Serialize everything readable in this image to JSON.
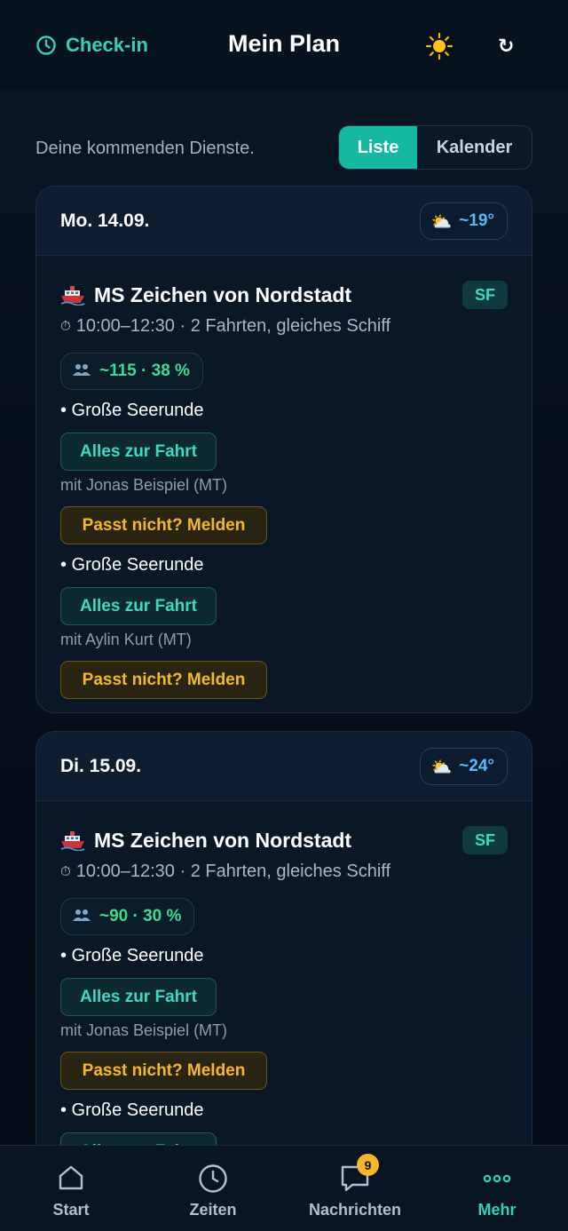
{
  "header": {
    "checkin_label": "Check-in",
    "title": "Mein Plan",
    "theme_icon": "sun-icon",
    "refresh_icon": "↻"
  },
  "subheader": {
    "subtitle": "Deine kommenden Dienste.",
    "view_toggle": {
      "list": "Liste",
      "calendar": "Kalender",
      "selected": "Liste"
    }
  },
  "days": [
    {
      "date": "Mo. 14.09.",
      "weather": {
        "icon": "⛅",
        "temp": "~19°"
      },
      "shift": {
        "ship": "MS Zeichen von Nordstadt",
        "badge": "SF",
        "clock_icon": "⏱",
        "time": "10:00–12:30 · 2 Fahrten, gleiches Schiff",
        "occupancy": "~115 · 38 %",
        "trips": [
          {
            "title": "• Große Seerunde",
            "details_label": "Alles zur Fahrt",
            "partner": "mit Jonas Beispiel (MT)",
            "report_label": "Passt nicht? Melden"
          },
          {
            "title": "• Große Seerunde",
            "details_label": "Alles zur Fahrt",
            "partner": "mit Aylin Kurt (MT)",
            "report_label": "Passt nicht? Melden"
          }
        ]
      }
    },
    {
      "date": "Di. 15.09.",
      "weather": {
        "icon": "⛅",
        "temp": "~24°"
      },
      "shift": {
        "ship": "MS Zeichen von Nordstadt",
        "badge": "SF",
        "clock_icon": "⏱",
        "time": "10:00–12:30 · 2 Fahrten, gleiches Schiff",
        "occupancy": "~90 · 30 %",
        "trips": [
          {
            "title": "• Große Seerunde",
            "details_label": "Alles zur Fahrt",
            "partner": "mit Jonas Beispiel (MT)",
            "report_label": "Passt nicht? Melden"
          },
          {
            "title": "• Große Seerunde",
            "details_label": "Alles zur Fahrt"
          }
        ]
      }
    }
  ],
  "bottom_nav": {
    "items": [
      {
        "label": "Start",
        "icon": "home-icon"
      },
      {
        "label": "Zeiten",
        "icon": "clock-icon"
      },
      {
        "label": "Nachrichten",
        "icon": "message-icon",
        "badge": "9"
      },
      {
        "label": "Mehr",
        "icon": "more-icon",
        "active": true
      }
    ]
  },
  "colors": {
    "accent": "#15b8a0",
    "warning": "#f5b82c",
    "weather": "#5cb8ff",
    "occupancy": "#3ddc8f"
  }
}
